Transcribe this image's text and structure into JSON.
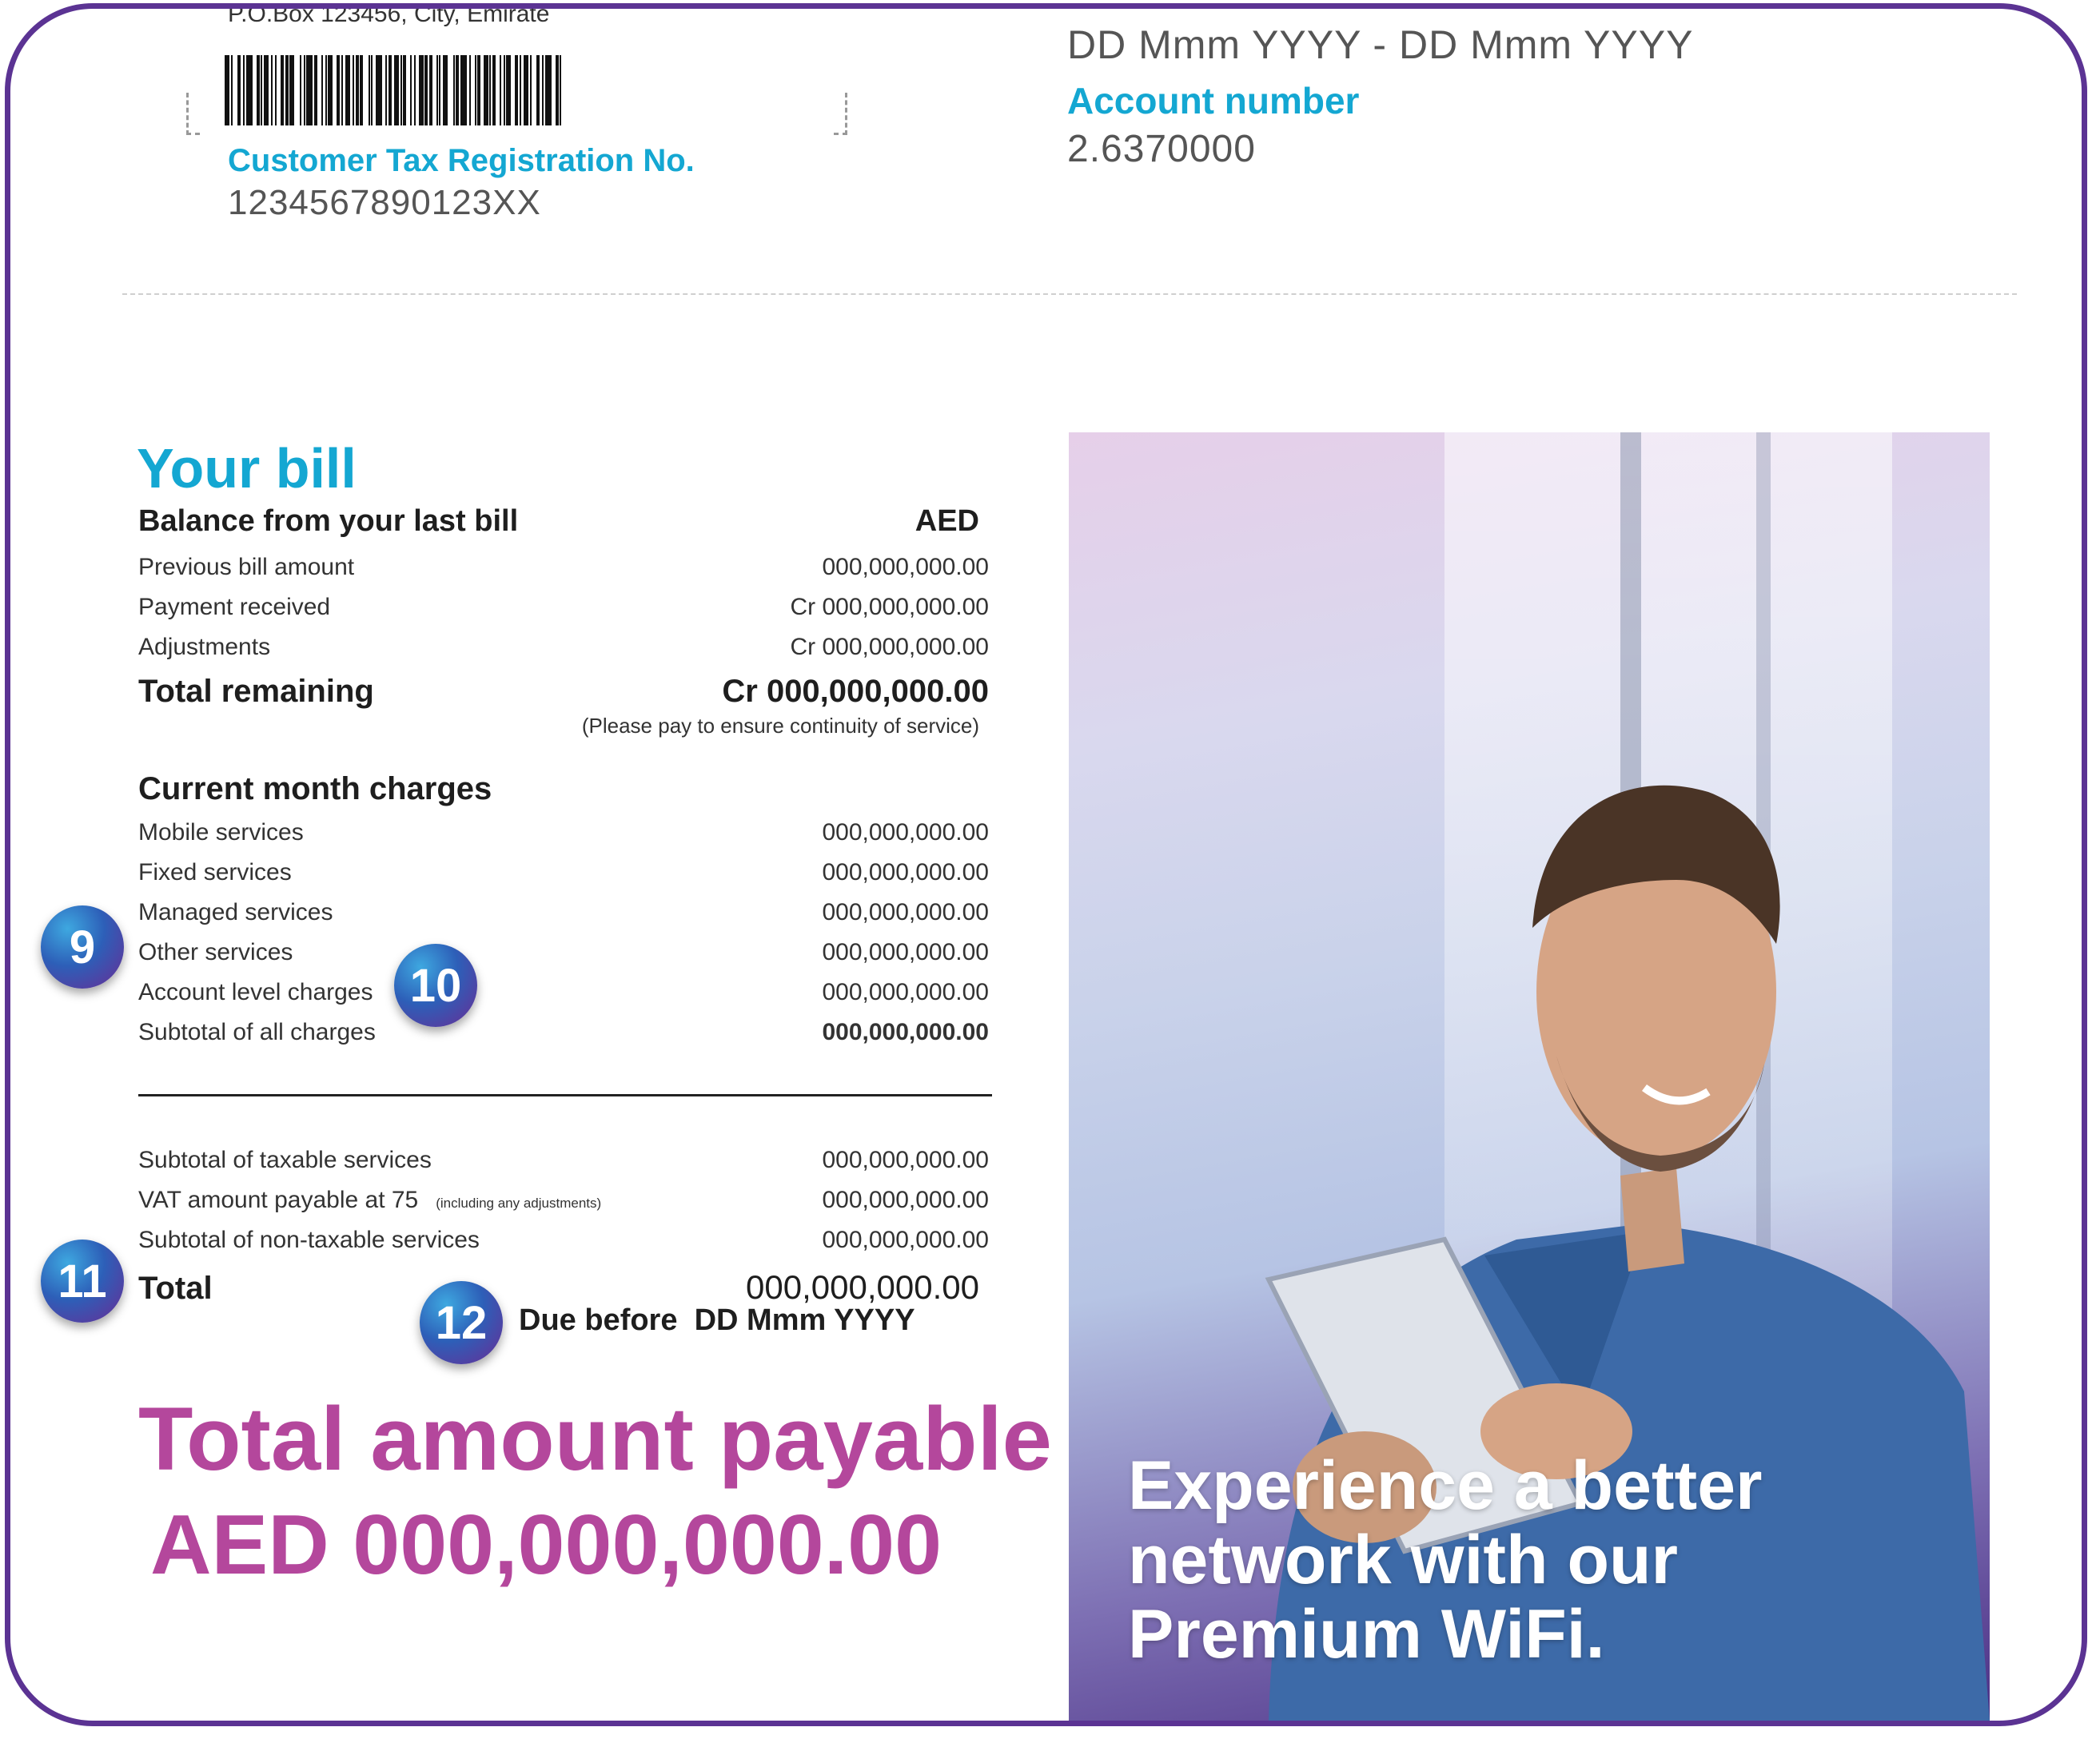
{
  "header": {
    "po_box": "P.O.Box 123456, City, Emirate",
    "tax_reg_label": "Customer Tax Registration No.",
    "tax_reg_value": "1234567890123XX",
    "period": "DD Mmm YYYY - DD Mmm YYYY",
    "account_label": "Account number",
    "account_value": "2.6370000"
  },
  "bill": {
    "title": "Your bill",
    "balance_heading": "Balance from your last bill",
    "currency": "AED",
    "previous_label": "Previous bill amount",
    "previous_value": "000,000,000.00",
    "payment_label": "Payment received",
    "payment_value": "Cr 000,000,000.00",
    "adjustments_label": "Adjustments",
    "adjustments_value": "Cr 000,000,000.00",
    "total_remaining_label": "Total remaining",
    "total_remaining_value": "Cr 000,000,000.00",
    "total_remaining_note": "(Please pay to ensure continuity of service)",
    "current_heading": "Current month charges",
    "mobile_label": "Mobile services",
    "mobile_value": "000,000,000.00",
    "fixed_label": "Fixed services",
    "fixed_value": "000,000,000.00",
    "managed_label": "Managed services",
    "managed_value": "000,000,000.00",
    "other_label": "Other services",
    "other_value": "000,000,000.00",
    "account_level_label": "Account level charges",
    "account_level_value": "000,000,000.00",
    "subtotal_all_label": "Subtotal of all charges",
    "subtotal_all_value": "000,000,000.00",
    "taxable_label": "Subtotal of taxable services",
    "taxable_value": "000,000,000.00",
    "vat_label": "VAT amount payable at 75",
    "vat_note": "(including any adjustments)",
    "vat_value": "000,000,000.00",
    "non_taxable_label": "Subtotal of non-taxable services",
    "non_taxable_value": "000,000,000.00",
    "total_label": "Total",
    "total_value": "000,000,000.00",
    "due_label": "Due before",
    "due_value": "DD Mmm YYYY",
    "payable_title": "Total amount payable",
    "payable_amount": "AED 000,000,000.00"
  },
  "badges": {
    "b9": "9",
    "b10": "10",
    "b11": "11",
    "b12": "12"
  },
  "promo": {
    "text": "Experience a better network with our Premium WiFi."
  },
  "colors": {
    "frame": "#5b3393",
    "accent_cyan": "#14a7d2",
    "accent_magenta": "#b4479c"
  }
}
